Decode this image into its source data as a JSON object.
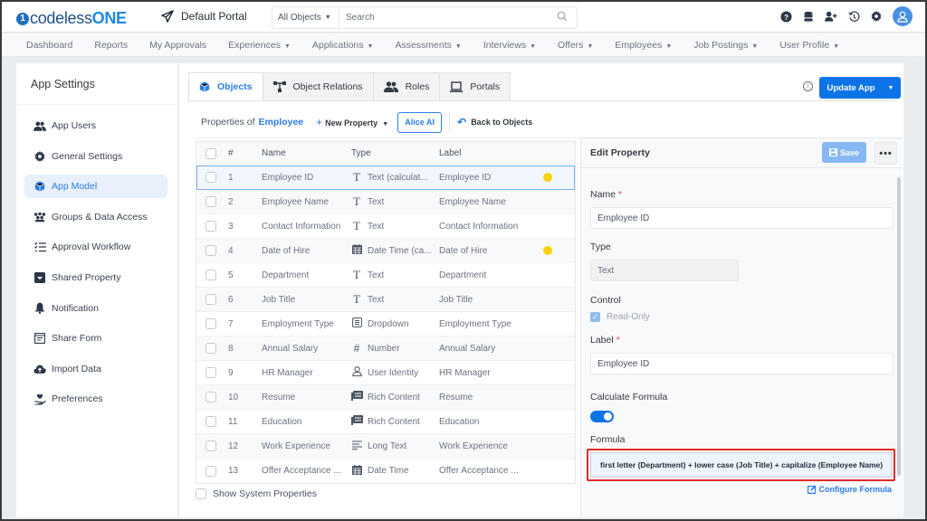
{
  "header": {
    "logo_prefix": "codeless",
    "logo_suffix": "ONE",
    "portal_name": "Default Portal",
    "search_scope": "All Objects",
    "search_placeholder": "Search",
    "icons": [
      "help-icon",
      "database-icon",
      "add-user-icon",
      "history-icon",
      "settings-icon",
      "user-avatar-icon"
    ]
  },
  "nav": {
    "items": [
      {
        "label": "Dashboard",
        "dropdown": false
      },
      {
        "label": "Reports",
        "dropdown": false
      },
      {
        "label": "My Approvals",
        "dropdown": false
      },
      {
        "label": "Experiences",
        "dropdown": true
      },
      {
        "label": "Applications",
        "dropdown": true
      },
      {
        "label": "Assessments",
        "dropdown": true
      },
      {
        "label": "Interviews",
        "dropdown": true
      },
      {
        "label": "Offers",
        "dropdown": true
      },
      {
        "label": "Employees",
        "dropdown": true
      },
      {
        "label": "Job Postings",
        "dropdown": true
      },
      {
        "label": "User Profile",
        "dropdown": true
      }
    ]
  },
  "sidebar": {
    "title": "App Settings",
    "items": [
      {
        "label": "App Users",
        "icon": "users-icon",
        "active": false
      },
      {
        "label": "General Settings",
        "icon": "gear-icon",
        "active": false
      },
      {
        "label": "App Model",
        "icon": "cube-icon",
        "active": true
      },
      {
        "label": "Groups & Data Access",
        "icon": "groups-icon",
        "active": false
      },
      {
        "label": "Approval Workflow",
        "icon": "checklist-icon",
        "active": false
      },
      {
        "label": "Shared Property",
        "icon": "inbox-icon",
        "active": false
      },
      {
        "label": "Notification",
        "icon": "bell-icon",
        "active": false
      },
      {
        "label": "Share Form",
        "icon": "form-icon",
        "active": false
      },
      {
        "label": "Import Data",
        "icon": "cloud-upload-icon",
        "active": false
      },
      {
        "label": "Preferences",
        "icon": "hand-heart-icon",
        "active": false
      }
    ]
  },
  "tabs": [
    {
      "label": "Objects",
      "icon": "cube-icon",
      "active": true
    },
    {
      "label": "Object Relations",
      "icon": "relations-icon",
      "active": false
    },
    {
      "label": "Roles",
      "icon": "users-icon",
      "active": false
    },
    {
      "label": "Portals",
      "icon": "laptop-icon",
      "active": false
    }
  ],
  "toolbar": {
    "update_app_label": "Update App",
    "properties_of_label": "Properties of",
    "object_name": "Employee",
    "new_property_label": "New Property",
    "alice_ai_label": "Alice AI",
    "back_label": "Back to Objects"
  },
  "table": {
    "columns": [
      "#",
      "Name",
      "Type",
      "Label"
    ],
    "rows": [
      {
        "num": "1",
        "name": "Employee ID",
        "type": "Text (calculat...",
        "type_icon": "text-icon",
        "label": "Employee ID",
        "flag": true,
        "selected": true
      },
      {
        "num": "2",
        "name": "Employee Name",
        "type": "Text",
        "type_icon": "text-icon",
        "label": "Employee Name",
        "flag": false
      },
      {
        "num": "3",
        "name": "Contact Information",
        "type": "Text",
        "type_icon": "text-icon",
        "label": "Contact Information",
        "flag": false
      },
      {
        "num": "4",
        "name": "Date of Hire",
        "type": "Date Time (ca...",
        "type_icon": "calendar-icon",
        "label": "Date of Hire",
        "flag": true
      },
      {
        "num": "5",
        "name": "Department",
        "type": "Text",
        "type_icon": "text-icon",
        "label": "Department",
        "flag": false
      },
      {
        "num": "6",
        "name": "Job Title",
        "type": "Text",
        "type_icon": "text-icon",
        "label": "Job Title",
        "flag": false
      },
      {
        "num": "7",
        "name": "Employment Type",
        "type": "Dropdown",
        "type_icon": "dropdown-icon",
        "label": "Employment Type",
        "flag": false
      },
      {
        "num": "8",
        "name": "Annual Salary",
        "type": "Number",
        "type_icon": "hash-icon",
        "label": "Annual Salary",
        "flag": false
      },
      {
        "num": "9",
        "name": "HR Manager",
        "type": "User Identity",
        "type_icon": "user-icon",
        "label": "HR Manager",
        "flag": false
      },
      {
        "num": "10",
        "name": "Resume",
        "type": "Rich Content",
        "type_icon": "rich-content-icon",
        "label": "Resume",
        "flag": false
      },
      {
        "num": "11",
        "name": "Education",
        "type": "Rich Content",
        "type_icon": "rich-content-icon",
        "label": "Education",
        "flag": false
      },
      {
        "num": "12",
        "name": "Work Experience",
        "type": "Long Text",
        "type_icon": "long-text-icon",
        "label": "Work Experience",
        "flag": false
      },
      {
        "num": "13",
        "name": "Offer Acceptance ...",
        "type": "Date Time",
        "type_icon": "calendar-icon",
        "label": "Offer Acceptance ...",
        "flag": false
      }
    ],
    "show_system_label": "Show System Properties"
  },
  "edit": {
    "title": "Edit Property",
    "save_label": "Save",
    "name_label": "Name",
    "name_value": "Employee ID",
    "type_label": "Type",
    "type_value": "Text",
    "control_label": "Control",
    "readonly_label": "Read-Only",
    "readonly_checked": true,
    "label_label": "Label",
    "label_value": "Employee ID",
    "calc_label": "Calculate Formula",
    "calc_on": true,
    "formula_label": "Formula",
    "formula_value": "first letter (Department) + lower case (Job Title) + capitalize (Employee Name)",
    "configure_label": "Configure Formula"
  },
  "colors": {
    "accent": "#0d74e7",
    "highlight_border": "#e02b2b",
    "flag_dot": "#f7d10e"
  }
}
